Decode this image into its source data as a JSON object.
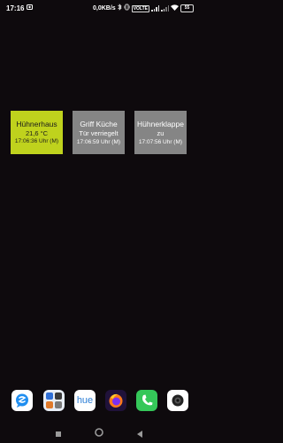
{
  "status_bar": {
    "time": "17:16",
    "net_speed": "0,0KB/s",
    "battery": "55",
    "volte_label": "VOLTE"
  },
  "widgets": [
    {
      "title": "Hühnerhaus",
      "line": "21,6 °C",
      "time": "17:06:36 Uhr (M)",
      "color": "#bfd21d"
    },
    {
      "title": "Griff Küche",
      "line": "Tür verriegelt",
      "time": "17:06:59 Uhr (M)",
      "color": "#858585"
    },
    {
      "title": "Hühnerklappe",
      "line": "zu",
      "time": "17:07:56 Uhr (M)",
      "color": "#858585"
    }
  ],
  "dock": {
    "apps": [
      {
        "icon": "chat-bubble-app-icon"
      },
      {
        "icon": "tools-folder-app-icon"
      },
      {
        "icon": "hue-app-icon",
        "label": "hue"
      },
      {
        "icon": "firefox-app-icon"
      },
      {
        "icon": "phone-app-icon"
      },
      {
        "icon": "camera-app-icon"
      }
    ]
  },
  "nav": [
    "recent-apps-icon",
    "home-icon",
    "back-icon"
  ]
}
